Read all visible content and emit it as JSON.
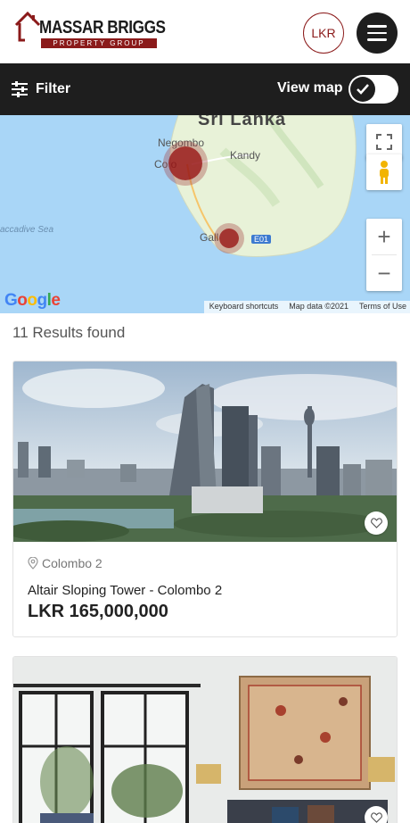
{
  "header": {
    "logo_title": "MASSAR BRIGGS",
    "logo_subtitle": "PROPERTY GROUP",
    "currency": "LKR",
    "menu_icon": "hamburger-icon"
  },
  "toolbar": {
    "filter_label": "Filter",
    "filter_icon": "sliders-icon",
    "view_map_label": "View map",
    "view_map_on": true
  },
  "map": {
    "labels": {
      "country": "Sri Lanka",
      "negombo": "Negombo",
      "colombo": "Co        o",
      "kandy": "Kandy",
      "galle": "Gall",
      "sea": "accadive Sea",
      "highway": "E01"
    },
    "google": "Google",
    "attribution": {
      "shortcuts": "Keyboard shortcuts",
      "data": "Map data ©2021",
      "terms": "Terms of Use"
    },
    "controls": {
      "fullscreen_icon": "fullscreen-icon",
      "pegman_icon": "street-view-pegman-icon",
      "zoom_in": "+",
      "zoom_out": "−"
    },
    "colors": {
      "water": "#a9d6f7",
      "land": "#e8f2d8",
      "marker": "#961414"
    }
  },
  "results": {
    "count_text": "11 Results found",
    "listings": [
      {
        "location": "Colombo 2",
        "title": "Altair Sloping Tower - Colombo 2",
        "price": "LKR 165,000,000"
      },
      {
        "location": "",
        "title": "",
        "price": ""
      }
    ]
  },
  "colors": {
    "brand_red": "#8b1a1a",
    "dark": "#1e1e1e"
  }
}
